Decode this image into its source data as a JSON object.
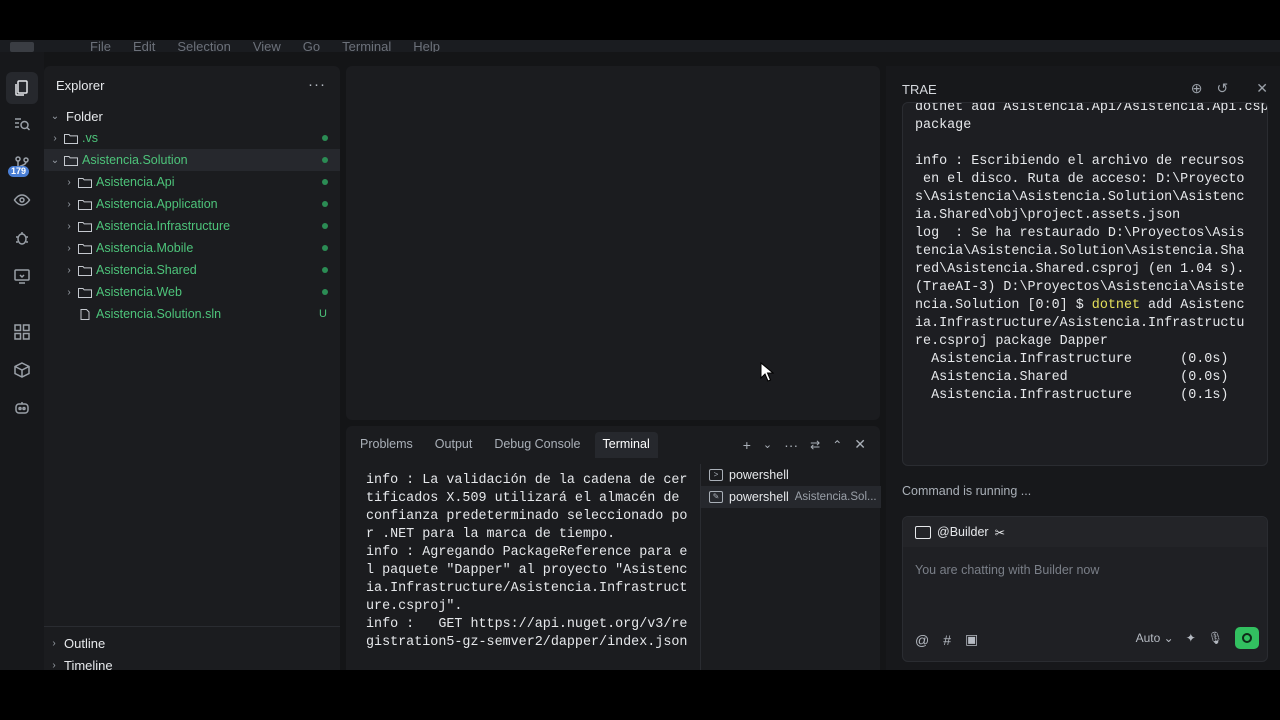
{
  "menubar": {
    "items": [
      "File",
      "Edit",
      "Selection",
      "View",
      "Go",
      "Terminal",
      "Help"
    ]
  },
  "activity": {
    "badge": "179"
  },
  "explorer": {
    "title": "Explorer",
    "more": "···",
    "root": "Folder",
    "items": [
      {
        "name": ".vs"
      },
      {
        "name": "Asistencia.Solution"
      },
      {
        "name": "Asistencia.Api"
      },
      {
        "name": "Asistencia.Application"
      },
      {
        "name": "Asistencia.Infrastructure"
      },
      {
        "name": "Asistencia.Mobile"
      },
      {
        "name": "Asistencia.Shared"
      },
      {
        "name": "Asistencia.Web"
      },
      {
        "name": "Asistencia.Solution.sln",
        "status": "U"
      }
    ],
    "outline": "Outline",
    "timeline": "Timeline"
  },
  "panel": {
    "tabs": [
      "Problems",
      "Output",
      "Debug Console",
      "Terminal"
    ],
    "terminal_text": "info : La validación de la cadena de cer\ntificados X.509 utilizará el almacén de\nconfianza predeterminado seleccionado po\nr .NET para la marca de tiempo.\ninfo : Agregando PackageReference para e\nl paquete \"Dapper\" al proyecto \"Asistenc\nia.Infrastructure/Asistencia.Infrastruct\nure.csproj\".\ninfo :   GET https://api.nuget.org/v3/re\ngistration5-gz-semver2/dapper/index.json",
    "terminals": [
      {
        "name": "powershell",
        "sub": ""
      },
      {
        "name": "powershell",
        "sub": "Asistencia.Sol..."
      }
    ]
  },
  "trae": {
    "title": "TRAE",
    "code_pre": "dotnet add Asistencia.Api/Asistencia.Api.csproj\npackage\n\ninfo : Escribiendo el archivo de recursos\n en el disco. Ruta de acceso: D:\\Proyecto\ns\\Asistencia\\Asistencia.Solution\\Asistenc\nia.Shared\\obj\\project.assets.json\nlog  : Se ha restaurado D:\\Proyectos\\Asis\ntencia\\Asistencia.Solution\\Asistencia.Sha\nred\\Asistencia.Shared.csproj (en 1.04 s).\n(TraeAI-3) D:\\Proyectos\\Asistencia\\Asiste\nncia.Solution [0:0] $ ",
    "code_kw": "dotnet",
    "code_post": " add Asistenc\nia.Infrastructure/Asistencia.Infrastructu\nre.csproj package Dapper\n  Asistencia.Infrastructure      (0.0s)\n  Asistencia.Shared              (0.0s)\n  Asistencia.Infrastructure      (0.1s)",
    "status": "Command is running ...",
    "chat": {
      "agent": "@Builder",
      "placeholder": "You are chatting with Builder now",
      "mode": "Auto"
    }
  }
}
